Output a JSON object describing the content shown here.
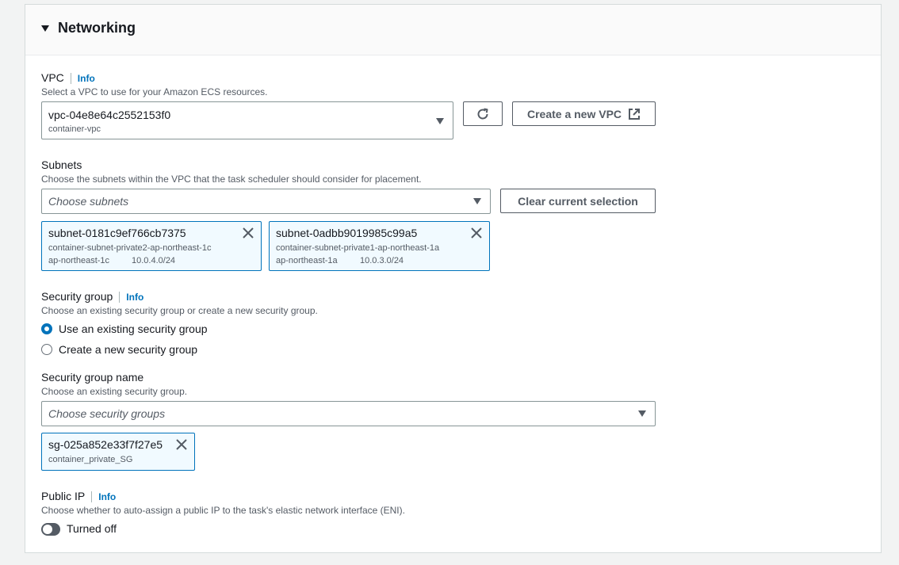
{
  "section": {
    "title": "Networking"
  },
  "info_label": "Info",
  "vpc": {
    "label": "VPC",
    "description": "Select a VPC to use for your Amazon ECS resources.",
    "selected_id": "vpc-04e8e64c2552153f0",
    "selected_name": "container-vpc",
    "create_button": "Create a new VPC",
    "refresh_icon": "refresh-icon",
    "external_icon": "external-link-icon"
  },
  "subnets": {
    "label": "Subnets",
    "description": "Choose the subnets within the VPC that the task scheduler should consider for placement.",
    "placeholder": "Choose subnets",
    "clear_button": "Clear current selection",
    "tokens": [
      {
        "id": "subnet-0181c9ef766cb7375",
        "name": "container-subnet-private2-ap-northeast-1c",
        "az": "ap-northeast-1c",
        "cidr": "10.0.4.0/24"
      },
      {
        "id": "subnet-0adbb9019985c99a5",
        "name": "container-subnet-private1-ap-northeast-1a",
        "az": "ap-northeast-1a",
        "cidr": "10.0.3.0/24"
      }
    ]
  },
  "security_group": {
    "label": "Security group",
    "description": "Choose an existing security group or create a new security group.",
    "options": [
      {
        "label": "Use an existing security group",
        "selected": true
      },
      {
        "label": "Create a new security group",
        "selected": false
      }
    ]
  },
  "security_group_name": {
    "label": "Security group name",
    "description": "Choose an existing security group.",
    "placeholder": "Choose security groups",
    "tokens": [
      {
        "id": "sg-025a852e33f7f27e5",
        "name": "container_private_SG"
      }
    ]
  },
  "public_ip": {
    "label": "Public IP",
    "description": "Choose whether to auto-assign a public IP to the task's elastic network interface (ENI).",
    "toggle_label": "Turned off",
    "enabled": false
  },
  "colors": {
    "accent": "#0073bb",
    "token_bg": "#f1faff",
    "text": "#16191f",
    "muted": "#545b64"
  }
}
